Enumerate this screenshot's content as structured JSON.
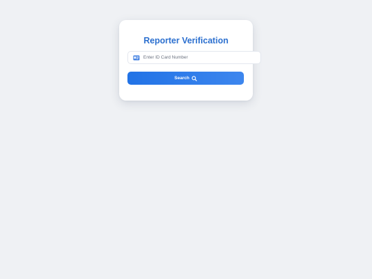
{
  "verification": {
    "title": "Reporter Verification",
    "id_input": {
      "value": "",
      "placeholder": "Enter ID Card Number",
      "icon": "id-card-icon"
    },
    "search_button": {
      "label": "Search",
      "icon": "search-icon"
    }
  },
  "colors": {
    "background": "#eff1f4",
    "title": "#2b6fcf",
    "button_gradient_start": "#2273e6",
    "button_gradient_end": "#3d86ee"
  }
}
